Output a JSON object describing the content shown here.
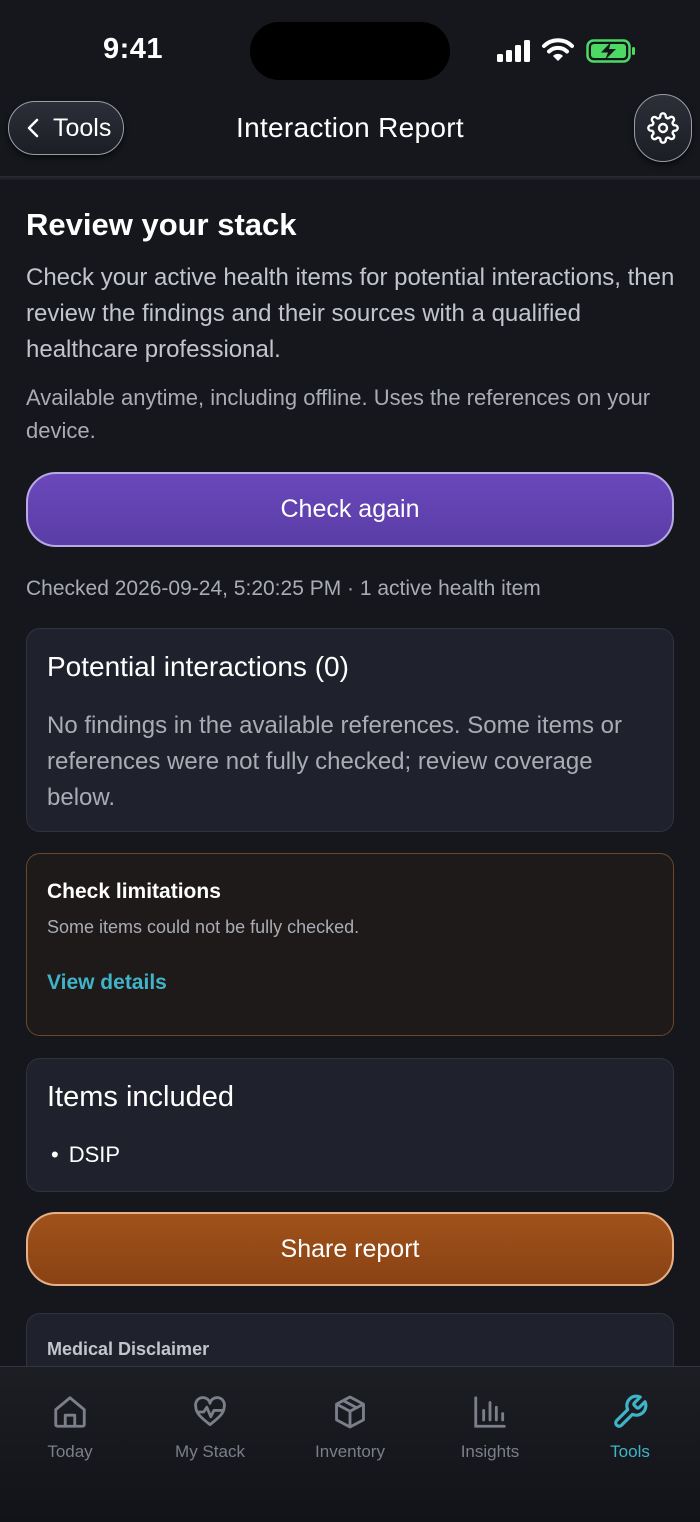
{
  "status_bar": {
    "time": "9:41"
  },
  "header": {
    "back_label": "Tools",
    "title": "Interaction Report"
  },
  "intro": {
    "heading": "Review your stack",
    "body": "Check your active health items for potential interactions, then review the findings and their sources with a qualified healthcare professional.",
    "note": "Available anytime, including offline. Uses the references on your device."
  },
  "actions": {
    "check_again": "Check again",
    "share_report": "Share report"
  },
  "checked_info": "Checked 2026-09-24, 5:20:25 PM · 1 active health item",
  "interactions_card": {
    "title": "Potential interactions (0)",
    "body": "No findings in the available references. Some items or references were not fully checked; review coverage below."
  },
  "limitations_card": {
    "title": "Check limitations",
    "body": "Some items could not be fully checked.",
    "link": "View details"
  },
  "items_card": {
    "title": "Items included",
    "items": [
      "DSIP"
    ]
  },
  "disclaimer_card": {
    "title": "Medical Disclaimer"
  },
  "tabbar": {
    "items": [
      {
        "label": "Today",
        "icon": "home-icon"
      },
      {
        "label": "My Stack",
        "icon": "heart-pulse-icon"
      },
      {
        "label": "Inventory",
        "icon": "box-icon"
      },
      {
        "label": "Insights",
        "icon": "bar-chart-icon"
      },
      {
        "label": "Tools",
        "icon": "wrench-icon"
      }
    ],
    "active": "Tools"
  },
  "colors": {
    "accent": "#3fb4c8",
    "primary_button": "#5f41ad",
    "share_button": "#944a17",
    "background": "#15171d"
  }
}
